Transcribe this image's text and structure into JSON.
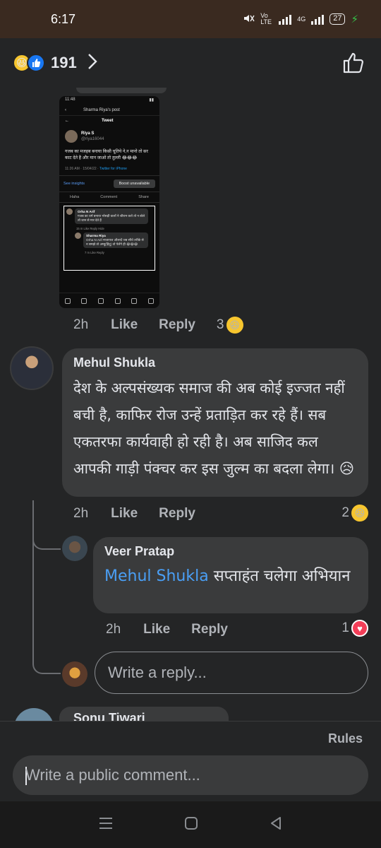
{
  "status_bar": {
    "time": "6:17",
    "net_label": "Vo LTE",
    "net_4g": "4G",
    "battery": "27"
  },
  "header": {
    "reaction_count": "191"
  },
  "embedded_screenshot": {
    "status_time": "11:48",
    "post_title": "Sharma Riya's post",
    "tweet_header": "Tweet",
    "user_name": "Riya S",
    "user_handle": "@riya16044",
    "tweet_text": "गजब का मजहब बनाया किसी चूतिये ने,न मानो तो सर काट देते है और मान जाओ तो तुल्ली 😂😂😂",
    "tweet_meta": "11:26 AM · 15/04/22 · ",
    "tweet_source": "Twitter for iPhone",
    "see_insights": "See insights",
    "boost": "Boost unavailable",
    "action_haha": "Haha",
    "action_comment": "Comment",
    "action_share": "Share",
    "c1_name": "Orha N Arif",
    "c1_text": "गजब का धर्म बनाया भोसड़ी वालों ने श्रीराम करो तो न बोले तो जान से मार देते हैं",
    "c1_meta": "15 m  Like  Reply  Hide",
    "c2_name": "Sharma Riya",
    "c2_text": "Orha N Arif नाजायज औलादें जब सीधे तरीके से न समझे तो अम्बु(हिंदू) तो पेलेंगे ही 😂😂😂",
    "c2_meta": "7 m  Like  Reply"
  },
  "post_meta": {
    "time": "2h",
    "like": "Like",
    "reply": "Reply",
    "reaction_count": "3"
  },
  "comment1": {
    "author": "Mehul Shukla",
    "text": "देश के अल्पसंख्यक समाज की अब कोई इज्जत नहीं बची है, काफिर रोज उन्हें प्रताड़ित कर रहे हैं। सब एकतरफा कार्यवाही हो रही है। अब साजिद कल आपकी गाड़ी पंक्चर कर इस जुल्म का बदला लेगा। 😥",
    "time": "2h",
    "like": "Like",
    "reply": "Reply",
    "reaction_count": "2"
  },
  "reply1": {
    "author": "Veer Pratap",
    "mention": "Mehul Shukla",
    "text": " सप्ताहंत चलेगा अभियान",
    "time": "2h",
    "like": "Like",
    "reply": "Reply",
    "reaction_count": "1"
  },
  "reply_input": {
    "placeholder": "Write a reply..."
  },
  "partial_comment": {
    "author": "Sonu Tiwari"
  },
  "footer": {
    "rules": "Rules",
    "comment_placeholder": "Write a public comment..."
  }
}
